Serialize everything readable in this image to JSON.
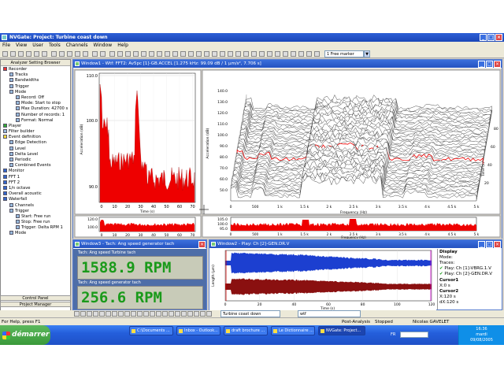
{
  "app": {
    "title": "NVGate: Project: Turbine coast down",
    "menu": [
      "File",
      "View",
      "User",
      "Tools",
      "Channels",
      "Window",
      "Help"
    ],
    "marker_select": "1 Free marker"
  },
  "browser": {
    "title": "Analyzer Setting Browser",
    "items": [
      "Recorder",
      "Tracks",
      "Bandwidths",
      "Trigger",
      "Mode",
      "Record: Off",
      "Mode: Start to stop",
      "Max Duration: 42700 s",
      "Number of records: 1",
      "Format: Normal",
      "Player",
      "Filter builder",
      "Event definition",
      "Edge Detection",
      "Level",
      "Delta Level",
      "Periodic",
      "Combined Events",
      "Monitor",
      "FFT 1",
      "FFT 2",
      "1/n octave",
      "Overall acoustic",
      "Waterfall",
      "Channels",
      "Trigger",
      "Start: Free run",
      "Stop: Free run",
      "Trigger: Delta RPM 1",
      "Mode"
    ],
    "control_panel": "Control Panel",
    "project_manager": "Project Manager"
  },
  "window1": {
    "title": "Window1 - Wtf: FFT2: Av5pc [1]-GB.ACCEL [1.275 kHz: 99.09 dB / 1 µm/s², 7.706 s]",
    "spec_ylabel": "Acceleration (dB)",
    "spec_xlabel": "Time (s)",
    "spec_yticks": [
      "110.0",
      "100.0",
      "90.0"
    ],
    "spec_xticks": [
      "0",
      "10",
      "20",
      "30",
      "40",
      "50",
      "60",
      "70"
    ],
    "mini_yticks": [
      "120.0",
      "100.0"
    ],
    "wf_ylabel": "Acceleration (dB)",
    "wf_yticks": [
      "140.0",
      "130.0",
      "120.0",
      "110.0",
      "100.0",
      "90.0",
      "80.0",
      "70.0",
      "60.0",
      "50.0"
    ],
    "wf_xlabel": "Frequency (Hz)",
    "wf_xticks": [
      "0",
      "500",
      "1 k",
      "1.5 k",
      "2 k",
      "2.5 k",
      "3 k",
      "3.5 k",
      "4 k",
      "4.5 k",
      "5 k"
    ],
    "wf_tticks": [
      "20",
      "40",
      "60",
      "80"
    ],
    "wf_tlabel": "Time (s)",
    "bot_yticks": [
      "105.0",
      "100.0",
      "95.0"
    ],
    "bot_xlabel": "Frequency (Hz)"
  },
  "window3": {
    "title": "Window3 - Tach: Ang speed generator tach",
    "label1": "Tach: Ang speed Turbine tach",
    "value1": "1588.9 RPM",
    "label2": "Tach: Ang speed generator tach",
    "value2": "256.6 RPM"
  },
  "window2": {
    "title": "Window2 - Play: Ch [2]-GEN.DR.V",
    "ylabel": "Length (µm)",
    "xlabel": "Time (s)",
    "xticks": [
      "0",
      "20",
      "40",
      "60",
      "80",
      "100",
      "120"
    ],
    "side": {
      "display": "Display",
      "mode": "Mode:",
      "traces": "Traces:",
      "trace1": "Play: Ch [1]-VBRG.1.V",
      "trace2": "Play: Ch [2]-GEN.DR.V",
      "cursor1": "Cursor1",
      "c1val": "X:0 s",
      "cursor2": "Cursor2",
      "c2val": "X:120 s",
      "dx": "dX:120 s"
    }
  },
  "bottom": {
    "combo1": "Turbine coast down",
    "combo2": "wtf"
  },
  "status": {
    "help": "For Help, press F1",
    "post": "Post-Analysis",
    "stopped": "Stopped",
    "user": "Nicolas GAVELET"
  },
  "taskbar": {
    "start": "démarrer",
    "tasks": [
      "C:\\Documents ...",
      "Inbox - Outlook...",
      "draft brochure ...",
      "Le Dictionnaire ...",
      "NVGate: Project..."
    ],
    "lang": "FR",
    "time": "16:36",
    "day": "mardi",
    "date": "09/08/2005"
  },
  "colors": {
    "trace_red": "#ee0000",
    "trace_blue": "#1c3fd0",
    "trace_dark": "#8a1010",
    "rpm_green": "#1a9a1a"
  }
}
